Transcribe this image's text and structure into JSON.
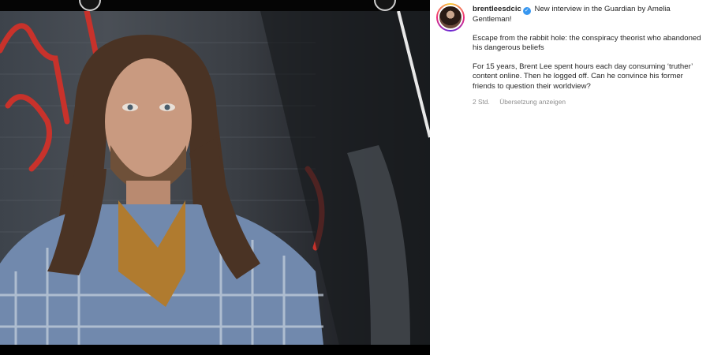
{
  "post": {
    "username": "brentleesdcic",
    "verified": true,
    "caption_intro": "New interview in the Guardian by Amelia Gentleman!",
    "headline": "Escape from the rabbit hole: the conspiracy theorist who abandoned his dangerous beliefs",
    "summary": "For 15 years, Brent Lee spent hours each day consuming ‘truther’ content online. Then he logged off. Can he convince his former friends to question their worldview?",
    "time_ago": "2 Std.",
    "translate_label": "Übersetzung anzeigen"
  },
  "icons": {
    "verified": "verified-badge-icon",
    "avatar": "profile-avatar"
  },
  "colors": {
    "accent_blue": "#3897f0",
    "text_primary": "#262626",
    "text_muted": "#8e8e8e"
  }
}
